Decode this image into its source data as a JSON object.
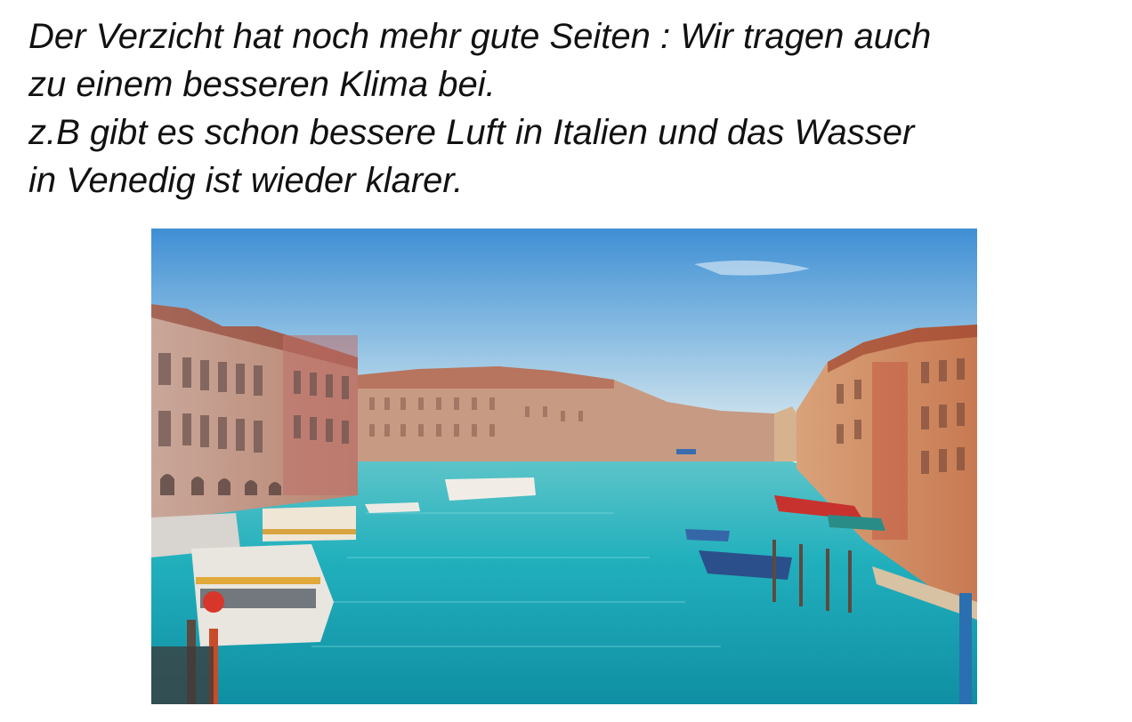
{
  "paragraph": {
    "lines": [
      "Der Verzicht hat noch mehr gute Seiten : Wir tragen auch",
      "zu einem besseren Klima bei.",
      "z.B gibt es schon bessere Luft in Italien und das Wasser",
      "in Venedig ist wieder klarer."
    ]
  },
  "photo": {
    "subject": "Venice Grand Canal with turquoise water and historic buildings",
    "colors": {
      "sky_top": "#3f8fd4",
      "sky_bottom": "#cfe3ec",
      "water": "#1fb3bf",
      "building_warm": "#d98a5c"
    }
  }
}
